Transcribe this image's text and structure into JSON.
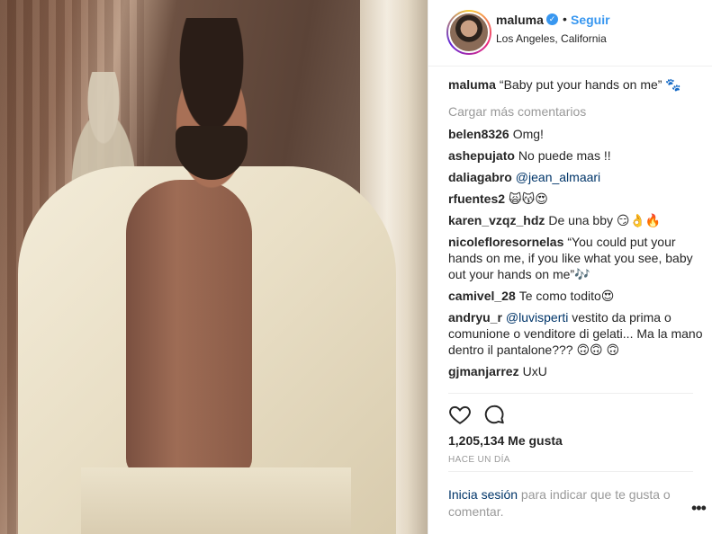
{
  "post": {
    "username": "maluma",
    "follow_label": "Seguir",
    "separator": "•",
    "location": "Los Angeles, California",
    "caption_text": "“Baby put your hands on me” 🐾",
    "load_more": "Cargar más comentarios"
  },
  "comments": [
    {
      "user": "belen8326",
      "text": "Omg!"
    },
    {
      "user": "ashepujato",
      "text": "No puede mas !!"
    },
    {
      "user": "daliagabro",
      "mention": "@jean_almaari",
      "text": ""
    },
    {
      "user": "rfuentes2",
      "text": "🙀😽😍"
    },
    {
      "user": "karen_vzqz_hdz",
      "text": "De una bby 😏👌🔥"
    },
    {
      "user": "nicolefloresornelas",
      "text": "“You could put your hands on me, if you like what you see, baby out your hands on me”🎶"
    },
    {
      "user": "camivel_28",
      "text": "Te como todito😍"
    },
    {
      "user": "andryu_r",
      "mention": "@luvisperti",
      "text": " vestito da prima o comunione o venditore di gelati... Ma la mano dentro il pantalone??? 🙃🙃 🙃"
    },
    {
      "user": "gjmanjarrez",
      "text": "UxU"
    }
  ],
  "stats": {
    "likes": "1,205,134 Me gusta",
    "time_ago": "HACE UN DÍA"
  },
  "footer": {
    "login_link": "Inicia sesión",
    "login_rest": " para indicar que te gusta o comentar.",
    "more": "•••"
  },
  "icons": {
    "like": "heart-outline-icon",
    "comment": "speech-bubble-icon",
    "verified": "verified-badge-icon",
    "more": "more-options-icon"
  },
  "colors": {
    "link_blue": "#3897f0",
    "mention_blue": "#003569",
    "muted": "#999999",
    "text": "#262626"
  }
}
